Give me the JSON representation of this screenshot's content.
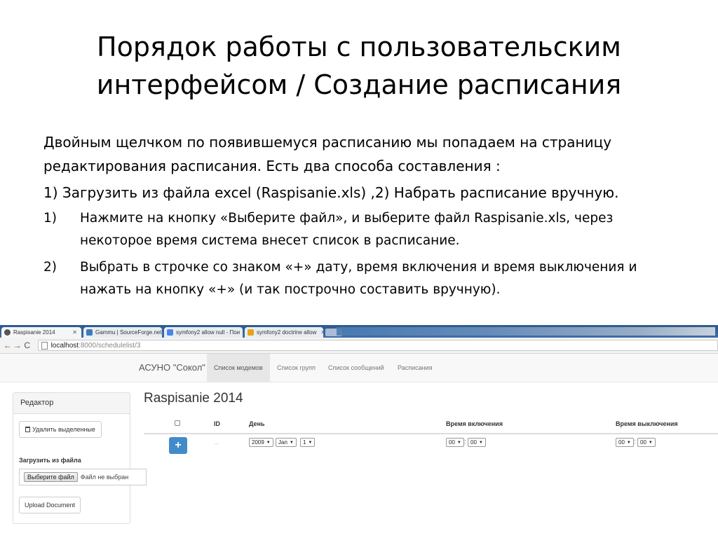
{
  "slide": {
    "title_line1": "Порядок работы с пользовательским",
    "title_line2": "интерфейсом / Создание расписания",
    "para1": "Двойным щелчком по появившемуся расписанию мы попадаем на страницу редактирования расписания. Есть два способа составления :",
    "para2": "1) Загрузить из файла excel (Raspisanie.xls) ,2) Набрать расписание вручную.",
    "steps": [
      {
        "num": "1)",
        "text": "Нажмите на кнопку «Выберите файл», и выберите файл Raspisanie.xls, через некоторое время система внесет список в расписание."
      },
      {
        "num": "2)",
        "text": "Выбрать в строчке со знаком «+» дату, время включения и время выключения и нажать на кнопку «+» (и так построчно составить вручную)."
      }
    ]
  },
  "browser": {
    "tabs": [
      {
        "label": "Raspisanie 2014",
        "color": "#555555"
      },
      {
        "label": "Gammu | SourceForge.net",
        "color": "#3b7bbf"
      },
      {
        "label": "symfony2 allow null - Пои",
        "color": "#4a86e8"
      },
      {
        "label": "symfony2 doctrine allow",
        "color": "#e8a317"
      }
    ],
    "url_host": "localhost",
    "url_rest": ":8000/schedulelist/3",
    "icons": {
      "back": "back-arrow-icon",
      "forward": "forward-arrow-icon",
      "reload": "reload-icon"
    }
  },
  "app": {
    "brand": "АСУНО \"Сокол\"",
    "nav": [
      "Список модемов",
      "Список групп",
      "Список сообщений",
      "Расписания"
    ],
    "sidebar": {
      "title": "Редактор",
      "delete_label": "Удалить выделенные",
      "load_label": "Загрузить из файла",
      "choose_file": "Выберите файл",
      "no_file": "Файл не выбран",
      "upload_label": "Upload Document"
    },
    "heading": "Raspisanie 2014",
    "table": {
      "headers": [
        "ID",
        "День",
        "Время включения",
        "Время выключения"
      ],
      "row": {
        "add_label": "+",
        "id": "...",
        "year": "2009",
        "month": "Jan",
        "day": "1",
        "on_hour": "00",
        "on_min": "00",
        "off_hour": "00",
        "off_min": "00"
      }
    }
  }
}
